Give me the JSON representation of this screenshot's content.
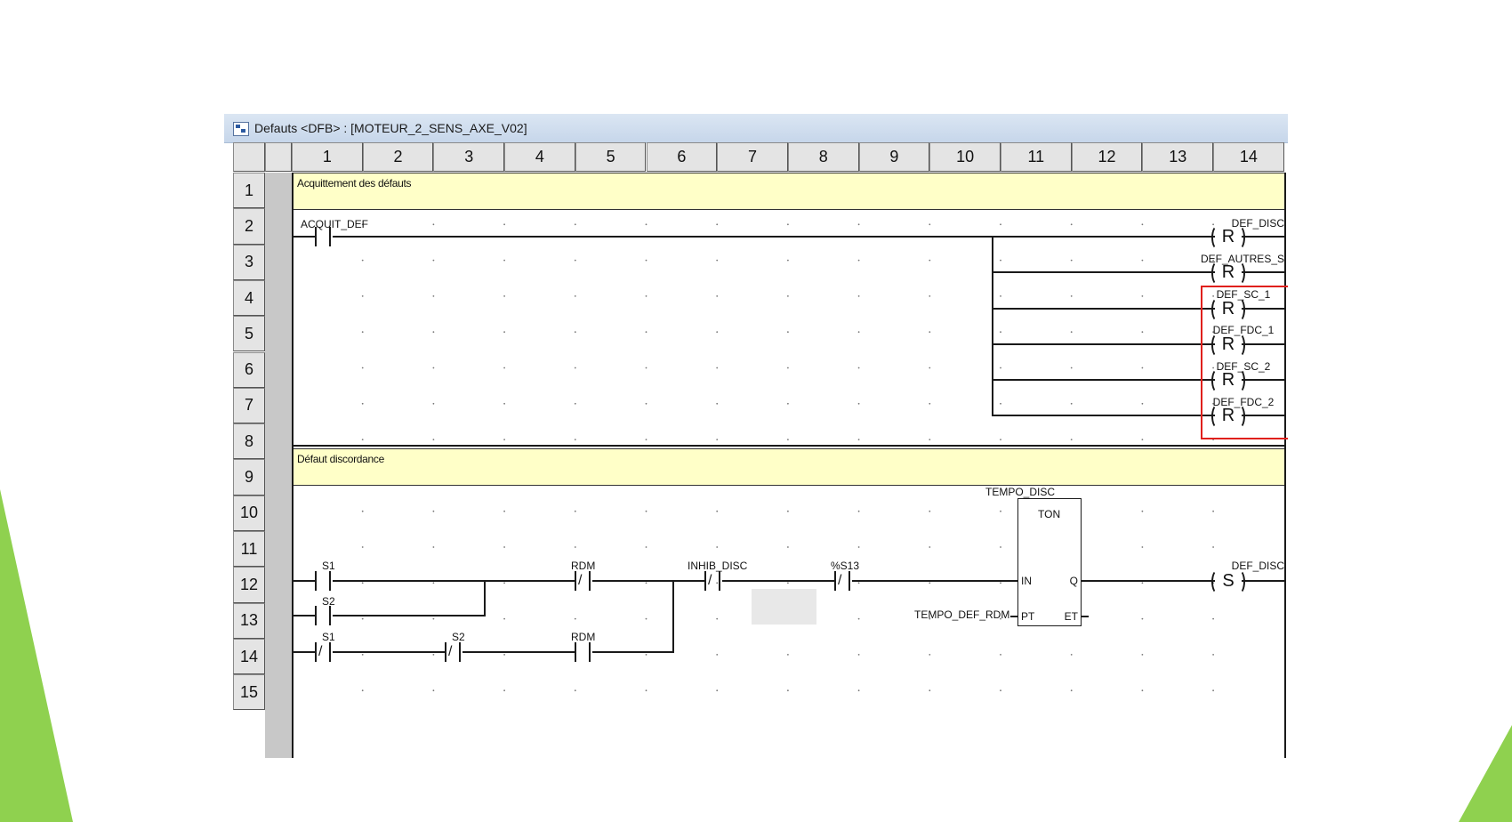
{
  "window": {
    "title": "Defauts <DFB> : [MOTEUR_2_SENS_AXE_V02]"
  },
  "columns": [
    "1",
    "2",
    "3",
    "4",
    "5",
    "6",
    "7",
    "8",
    "9",
    "10",
    "11",
    "12",
    "13",
    "14"
  ],
  "rows": [
    "1",
    "2",
    "3",
    "4",
    "5",
    "6",
    "7",
    "8",
    "9",
    "10",
    "11",
    "12",
    "13",
    "14",
    "15"
  ],
  "section1": {
    "comment": "Acquittement des défauts",
    "contact_acquit": "ACQUIT_DEF",
    "coils": [
      {
        "var": "DEF_DISC",
        "type": "R"
      },
      {
        "var": "DEF_AUTRES_S",
        "type": "R"
      },
      {
        "var": "DEF_SC_1",
        "type": "R"
      },
      {
        "var": "DEF_FDC_1",
        "type": "R"
      },
      {
        "var": "DEF_SC_2",
        "type": "R"
      },
      {
        "var": "DEF_FDC_2",
        "type": "R"
      }
    ]
  },
  "section2": {
    "comment": "Défaut discordance",
    "c_s1": "S1",
    "c_s2": "S2",
    "c_s1b": "S1",
    "c_s2b": "S2",
    "c_rdm1": "RDM",
    "c_rdm2": "RDM",
    "c_inhib": "INHIB_DISC",
    "c_s13": "%S13",
    "fb_instance": "TEMPO_DISC",
    "fb_type": "TON",
    "fb_in": "IN",
    "fb_q": "Q",
    "fb_pt": "PT",
    "fb_et": "ET",
    "pt_var": "TEMPO_DEF_RDM",
    "coil_var": "DEF_DISC",
    "coil_type": "S"
  },
  "colors": {
    "comment_bg": "#ffffc8",
    "highlight": "#e0201c",
    "accent_green": "#8fd14f"
  }
}
